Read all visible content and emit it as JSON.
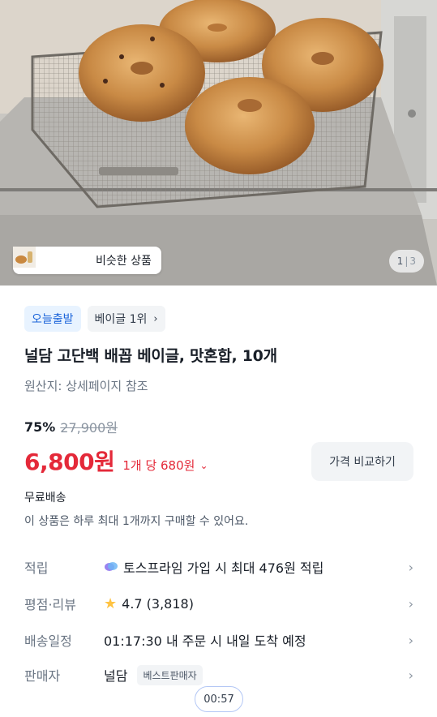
{
  "hero": {
    "similar_label": "비슷한 상품",
    "pager_current": "1",
    "pager_separator": "|",
    "pager_total": "3"
  },
  "tags": {
    "today": "오늘출발",
    "rank": "베이글 1위",
    "rank_chevron_icon": "chevron-right-icon"
  },
  "product": {
    "title": "널담 고단백 배꼽 베이글, 맛혼합, 10개",
    "origin": "원산지: 상세페이지 참조",
    "discount": "75%",
    "original_price": "27,900원",
    "price": "6,800원",
    "unit_price": "1개 당 680원",
    "compare_button": "가격 비교하기",
    "shipping": "무료배송",
    "purchase_limit": "이 상품은 하루 최대 1개까지 구매할 수 있어요."
  },
  "info": {
    "points_label": "적립",
    "points_value": "토스프라임 가입 시 최대 476원 적립",
    "rating_label": "평점·리뷰",
    "rating_value": "4.7 (3,818)",
    "delivery_label": "배송일정",
    "delivery_value": "01:17:30 내 주문 시 내일 도착 예정",
    "seller_label": "판매자",
    "seller_value": "널담",
    "seller_badge": "베스트판매자"
  },
  "timer": "00:57",
  "colors": {
    "price_red": "#e42939",
    "tag_blue": "#1b64da",
    "tag_blue_bg": "#e8f3ff",
    "star": "#ffc342"
  }
}
